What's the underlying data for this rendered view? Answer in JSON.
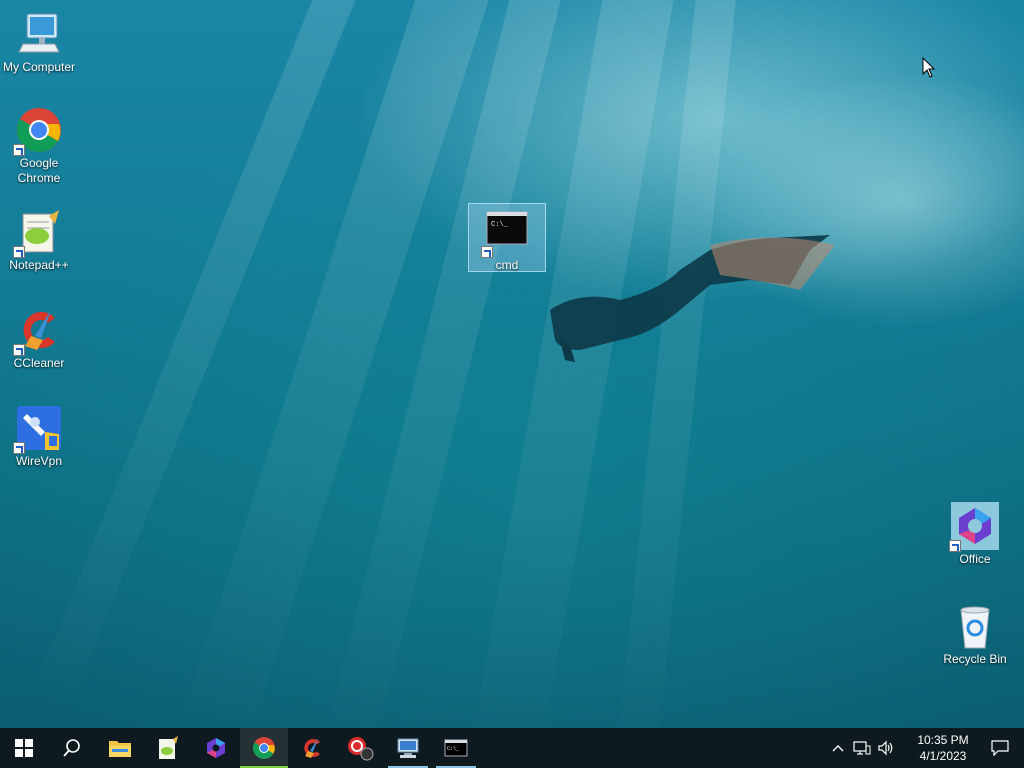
{
  "desktop": {
    "icons": [
      {
        "label": "My Computer"
      },
      {
        "label": "Google\nChrome"
      },
      {
        "label": "Notepad++"
      },
      {
        "label": "CCleaner"
      },
      {
        "label": "WireVpn"
      },
      {
        "label": "cmd"
      },
      {
        "label": "Office"
      },
      {
        "label": "Recycle Bin"
      }
    ]
  },
  "taskbar": {
    "clock_time": "10:35 PM",
    "clock_date": "4/1/2023"
  },
  "colors": {
    "taskbar_bg": "#0e1a20",
    "chrome_active_underline": "#7ad03a",
    "running_underline": "#8cc4e8"
  }
}
